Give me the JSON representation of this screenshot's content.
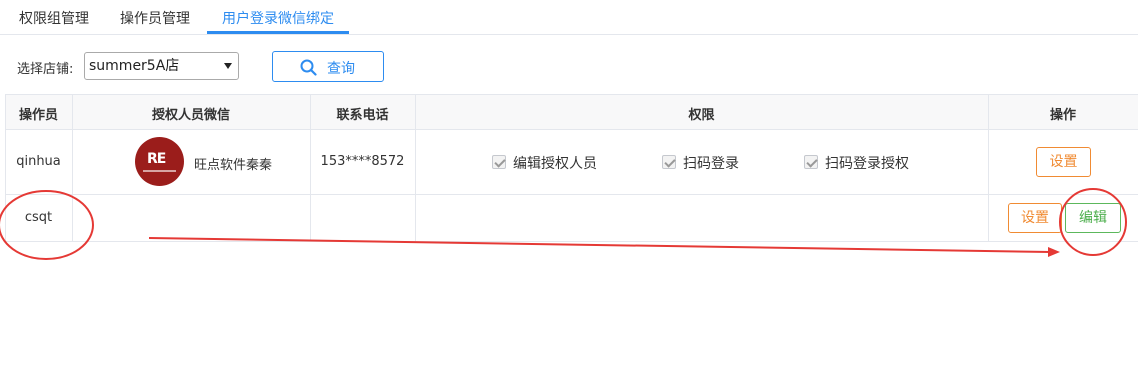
{
  "tabs": [
    {
      "label": "权限组管理"
    },
    {
      "label": "操作员管理"
    },
    {
      "label": "用户登录微信绑定"
    }
  ],
  "filter": {
    "store_label": "选择店铺:",
    "store_value": "summer5A店",
    "query_label": "查询"
  },
  "table": {
    "headers": [
      "操作员",
      "授权人员微信",
      "联系电话",
      "权限",
      "操作"
    ],
    "rows": [
      {
        "operator": "qinhua",
        "wechat_name": "旺点软件秦秦",
        "phone": "153****8572",
        "permissions": [
          "编辑授权人员",
          "扫码登录",
          "扫码登录授权"
        ],
        "actions": [
          "设置"
        ]
      },
      {
        "operator": "csqt",
        "wechat_name": "",
        "phone": "",
        "permissions": [],
        "actions": [
          "设置",
          "编辑"
        ]
      }
    ]
  },
  "colors": {
    "accent": "#2d8cf0",
    "orange": "#f08b33",
    "green": "#5cb85c",
    "annotation": "#e53935"
  }
}
